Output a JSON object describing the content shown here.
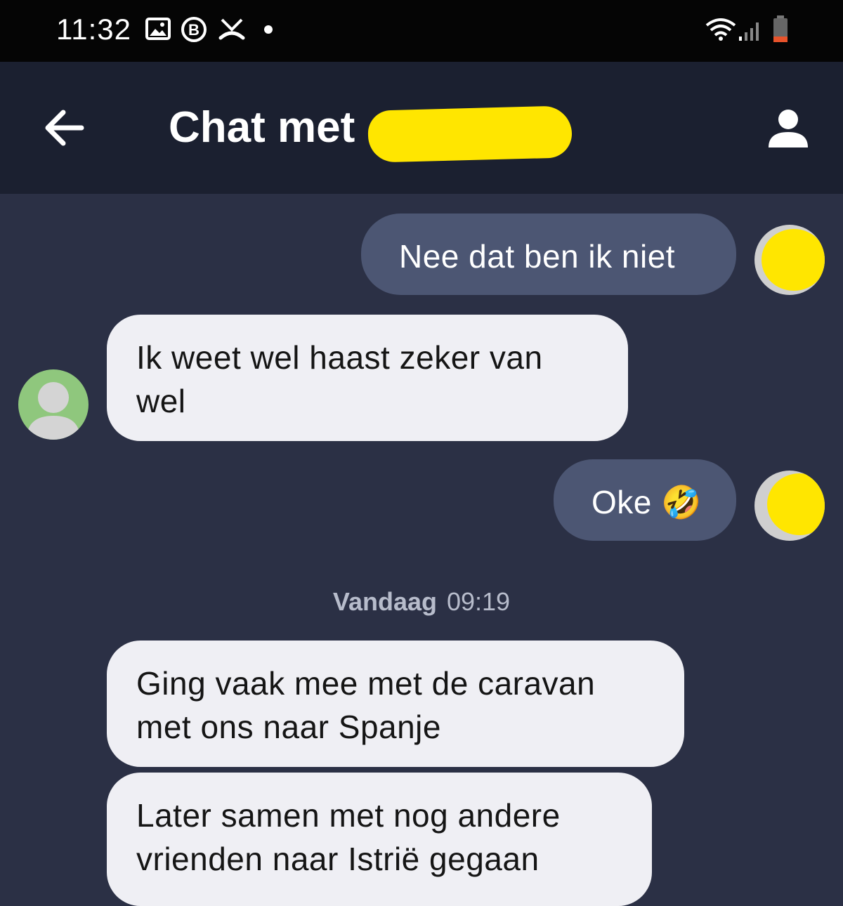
{
  "status_bar": {
    "time": "11:32",
    "icons": [
      "image-icon",
      "b-badge-icon",
      "missed-call-icon",
      "dot-icon",
      "wifi-icon",
      "signal-icon",
      "battery-icon"
    ]
  },
  "header": {
    "title": "Chat met",
    "back_icon": "arrow-left-icon",
    "profile_icon": "person-icon"
  },
  "messages": [
    {
      "sender": "me",
      "text": "Nee dat ben ik niet"
    },
    {
      "sender": "them",
      "text": "Ik weet wel haast zeker van wel"
    },
    {
      "sender": "me",
      "text": "Oke 🤣"
    }
  ],
  "date_separator": {
    "day": "Vandaag",
    "time": "09:19"
  },
  "messages_after": [
    {
      "sender": "them",
      "text": "Ging vaak mee met de caravan met ons naar Spanje"
    },
    {
      "sender": "them",
      "text": "Later samen met nog andere vrienden naar Istrië gegaan"
    }
  ],
  "colors": {
    "background": "#2b3045",
    "app_bar": "#1b2030",
    "my_bubble": "#4c5673",
    "their_bubble": "#efeff4",
    "redaction": "#ffe600"
  }
}
